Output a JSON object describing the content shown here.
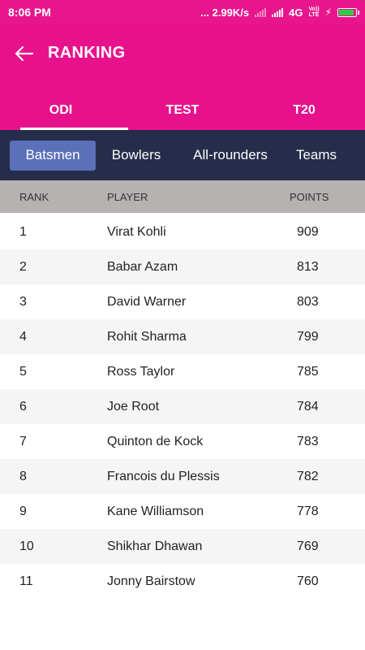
{
  "status_bar": {
    "time": "8:06 PM",
    "speed": "... 2.99K/s",
    "network": "4G",
    "volte_top": "Vo))",
    "volte_bottom": "LTE",
    "battery_color": "#2ecc40"
  },
  "header": {
    "title": "RANKING",
    "back_icon": "arrow-left-icon",
    "background": "#e8118c"
  },
  "tabs": [
    {
      "label": "ODI",
      "active": true
    },
    {
      "label": "TEST",
      "active": false
    },
    {
      "label": "T20",
      "active": false
    }
  ],
  "filters": [
    {
      "label": "Batsmen",
      "active": true
    },
    {
      "label": "Bowlers",
      "active": false
    },
    {
      "label": "All-rounders",
      "active": false
    },
    {
      "label": "Teams",
      "active": false
    }
  ],
  "table": {
    "columns": {
      "rank": "RANK",
      "player": "PLAYER",
      "points": "POINTS"
    },
    "rows": [
      {
        "rank": "1",
        "player": "Virat Kohli",
        "points": "909"
      },
      {
        "rank": "2",
        "player": "Babar Azam",
        "points": "813"
      },
      {
        "rank": "3",
        "player": "David Warner",
        "points": "803"
      },
      {
        "rank": "4",
        "player": "Rohit Sharma",
        "points": "799"
      },
      {
        "rank": "5",
        "player": "Ross Taylor",
        "points": "785"
      },
      {
        "rank": "6",
        "player": "Joe Root",
        "points": "784"
      },
      {
        "rank": "7",
        "player": "Quinton de Kock",
        "points": "783"
      },
      {
        "rank": "8",
        "player": "Francois du Plessis",
        "points": "782"
      },
      {
        "rank": "9",
        "player": "Kane Williamson",
        "points": "778"
      },
      {
        "rank": "10",
        "player": "Shikhar Dhawan",
        "points": "769"
      },
      {
        "rank": "11",
        "player": "Jonny Bairstow",
        "points": "760"
      }
    ]
  }
}
